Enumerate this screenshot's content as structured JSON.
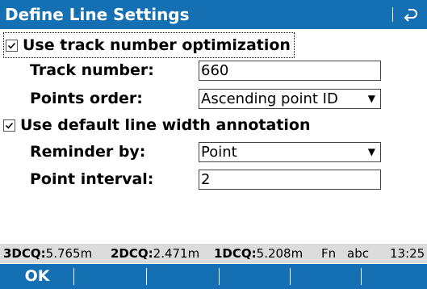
{
  "titlebar": {
    "title": "Define Line Settings",
    "back_icon": "return-arrow-icon"
  },
  "form": {
    "track_opt": {
      "label": "Use track number optimization",
      "checked": true
    },
    "track_number": {
      "label": "Track number:",
      "value": "660"
    },
    "points_order": {
      "label": "Points order:",
      "value": "Ascending point ID",
      "arrow": "▼"
    },
    "default_width": {
      "label": "Use default line width annotation",
      "checked": true
    },
    "reminder_by": {
      "label": "Reminder by:",
      "value": "Point",
      "arrow": "▼"
    },
    "point_interval": {
      "label": "Point interval:",
      "value": "2"
    }
  },
  "statusbar": {
    "dcq3_label": "3DCQ:",
    "dcq3_value": "5.765m",
    "dcq2_label": "2DCQ:",
    "dcq2_value": "2.471m",
    "dcq1_label": "1DCQ:",
    "dcq1_value": "5.208m",
    "fn": "Fn",
    "input_mode": "abc",
    "time": "13:25"
  },
  "softkeys": {
    "f1": "OK",
    "f2": "",
    "f3": "",
    "f4": "",
    "f5": "",
    "f6": ""
  },
  "colors": {
    "bar_blue": "#1570b3",
    "status_gray": "#dcdcdc"
  }
}
